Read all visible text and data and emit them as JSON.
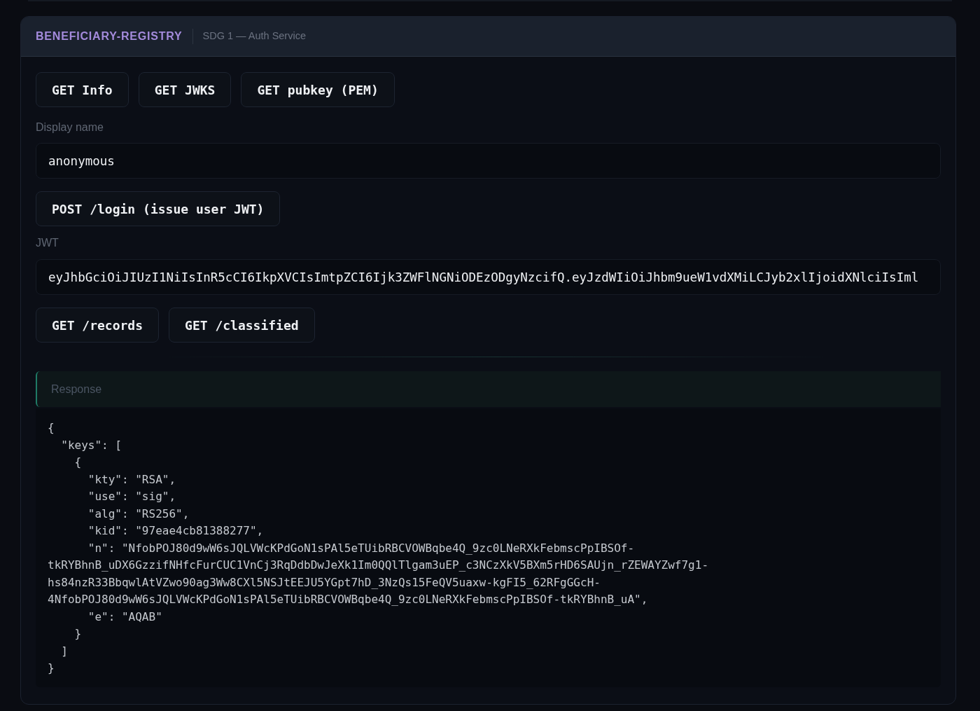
{
  "header": {
    "title": "BENEFICIARY-REGISTRY",
    "subtitle": "SDG 1 — Auth Service"
  },
  "key_buttons": [
    "GET Info",
    "GET JWKS",
    "GET pubkey (PEM)"
  ],
  "display_name": {
    "label": "Display name",
    "value": "anonymous"
  },
  "login_button": "POST /login (issue user JWT)",
  "jwt": {
    "label": "JWT",
    "value": "eyJhbGciOiJIUzI1NiIsInR5cCI6IkpXVCIsImtpZCI6Ijk3ZWFlNGNiODEzODgyNzcifQ.eyJzdWIiOiJhbm9ueW1vdXMiLCJyb2xlIjoidXNlciIsIml"
  },
  "api_buttons": [
    "GET /records",
    "GET /classified"
  ],
  "response": {
    "title": "Response",
    "lines": [
      "{",
      "  \"keys\": [",
      "    {",
      "      \"kty\": \"RSA\",",
      "      \"use\": \"sig\",",
      "      \"alg\": \"RS256\",",
      "      \"kid\": \"97eae4cb81388277\",",
      "      \"n\": \"NfobPOJ80d9wW6sJQLVWcKPdGoN1sPAl5eTUibRBCVOWBqbe4Q_9zc0LNeRXkFebmscPpIBSOf-",
      "tkRYBhnB_uDX6GzzifNHfcFurCUC1VnCj3RqDdbDwJeXk1Im0QQlTlgam3uEP_c3NCzXkV5BXm5rHD6SAUjn_rZEWAYZwf7g1-",
      "hs84nzR33BbqwlAtVZwo90ag3Ww8CXl5NSJtEEJU5YGpt7hD_3NzQs15FeQV5uaxw-kgFI5_62RFgGGcH-",
      "4NfobPOJ80d9wW6sJQLVWcKPdGoN1sPAl5eTUibRBCVOWBqbe4Q_9zc0LNeRXkFebmscPpIBSOf-tkRYBhnB_uA\",",
      "      \"e\": \"AQAB\"",
      "    }",
      "  ]",
      "}"
    ]
  }
}
